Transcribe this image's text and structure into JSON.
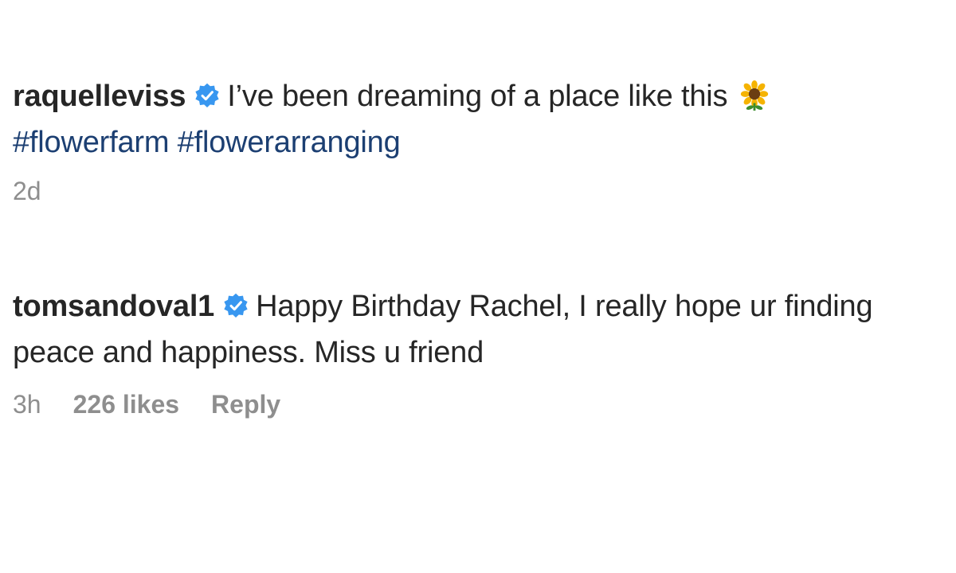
{
  "comments": [
    {
      "username": "raquelleviss",
      "verified": true,
      "text": "I’ve been dreaming of a place like this",
      "emoji": "sunflower-icon",
      "hashtags": [
        "#flowerfarm",
        "#flowerarranging"
      ],
      "time": "2d"
    },
    {
      "username": "tomsandoval1",
      "verified": true,
      "text": "Happy Birthday Rachel, I really hope ur finding peace and happiness. Miss u friend",
      "time": "3h",
      "likes": "226 likes",
      "reply_label": "Reply"
    }
  ],
  "colors": {
    "text": "#262626",
    "muted": "#8e8e8e",
    "hashtag": "#1c3f72",
    "verified": "#3897f0"
  }
}
